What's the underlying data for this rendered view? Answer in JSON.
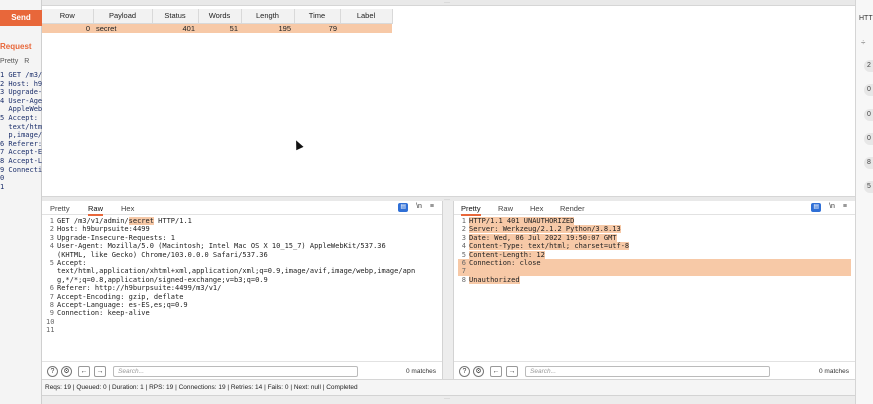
{
  "background_left": {
    "send_label": "Send",
    "request_heading": "Request",
    "tabs": [
      "Pretty",
      "R"
    ],
    "lines": [
      "1 GET /m3/",
      "2 Host: h9",
      "3 Upgrade-",
      "4 User-Age",
      "  AppleWeb",
      "5 Accept:",
      "  text/htm",
      "  p,image/",
      "6 Referer:",
      "7 Accept-E",
      "8 Accept-L",
      "9 Connecti",
      "0",
      "1"
    ]
  },
  "background_right": {
    "header_text": "HTT",
    "numbers": [
      "2",
      "0",
      "0",
      "0",
      "8",
      "5"
    ]
  },
  "results_table": {
    "columns": [
      "Row",
      "Payload",
      "Status",
      "Words",
      "Length",
      "Time",
      "Label"
    ],
    "rows": [
      {
        "row": "0",
        "payload": "secret",
        "status": "401",
        "words": "51",
        "length": "195",
        "time": "79",
        "label": ""
      }
    ]
  },
  "request_pane": {
    "tabs": [
      "Pretty",
      "Raw",
      "Hex"
    ],
    "active_tab": "Raw",
    "icons": [
      "message-icon",
      "newline-icon",
      "menu-icon"
    ],
    "newline_label": "\\n",
    "lines": [
      {
        "n": "1",
        "pre": "GET /m3/v1/admin/",
        "hl": "secret",
        "post": " HTTP/1.1"
      },
      {
        "n": "2",
        "pre": "Host: h9burpsuite:4499",
        "hl": "",
        "post": ""
      },
      {
        "n": "3",
        "pre": "Upgrade-Insecure-Requests: 1",
        "hl": "",
        "post": ""
      },
      {
        "n": "4",
        "pre": "User-Agent: Mozilla/5.0 (Macintosh; Intel Mac OS X 10_15_7) AppleWebKit/537.36",
        "hl": "",
        "post": ""
      },
      {
        "n": "",
        "pre": "(KHTML, like Gecko) Chrome/103.0.0.0 Safari/537.36",
        "hl": "",
        "post": ""
      },
      {
        "n": "5",
        "pre": "Accept:",
        "hl": "",
        "post": ""
      },
      {
        "n": "",
        "pre": "text/html,application/xhtml+xml,application/xml;q=0.9,image/avif,image/webp,image/apn",
        "hl": "",
        "post": ""
      },
      {
        "n": "",
        "pre": "g,*/*;q=0.8,application/signed-exchange;v=b3;q=0.9",
        "hl": "",
        "post": ""
      },
      {
        "n": "6",
        "pre": "Referer: http://h9burpsuite:4499/m3/v1/",
        "hl": "",
        "post": ""
      },
      {
        "n": "7",
        "pre": "Accept-Encoding: gzip, deflate",
        "hl": "",
        "post": ""
      },
      {
        "n": "8",
        "pre": "Accept-Language: es-ES,es;q=0.9",
        "hl": "",
        "post": ""
      },
      {
        "n": "9",
        "pre": "Connection: keep-alive",
        "hl": "",
        "post": ""
      },
      {
        "n": "10",
        "pre": "",
        "hl": "",
        "post": ""
      },
      {
        "n": "11",
        "pre": "",
        "hl": "",
        "post": ""
      }
    ],
    "search_placeholder": "Search...",
    "matches": "0 matches"
  },
  "response_pane": {
    "tabs": [
      "Pretty",
      "Raw",
      "Hex",
      "Render"
    ],
    "active_tab": "Pretty",
    "icons": [
      "message-icon",
      "newline-icon",
      "menu-icon"
    ],
    "newline_label": "\\n",
    "lines": [
      {
        "n": "1",
        "text": "HTTP/1.1 401 UNAUTHORIZED",
        "full": false
      },
      {
        "n": "2",
        "text": "Server: Werkzeug/2.1.2 Python/3.8.13",
        "full": false
      },
      {
        "n": "3",
        "text": "Date: Wed, 06 Jul 2022 19:50:07 GMT",
        "full": false
      },
      {
        "n": "4",
        "text": "Content-Type: text/html; charset=utf-8",
        "full": false
      },
      {
        "n": "5",
        "text": "Content-Length: 12",
        "full": false
      },
      {
        "n": "6",
        "text": "Connection: close",
        "full": true
      },
      {
        "n": "7",
        "text": "",
        "full": true
      },
      {
        "n": "8",
        "text": "Unauthorized",
        "full": false
      }
    ],
    "search_placeholder": "Search...",
    "matches": "0 matches"
  },
  "status_bar": {
    "text": "Reqs: 19 | Queued: 0 | Duration: 1 | RPS: 19 | Connections: 19 | Retries: 14 | Fails: 0 | Next: null | Completed"
  },
  "colors": {
    "accent": "#e8673a",
    "highlight": "#f7c9a7",
    "link_blue": "#2f6fd6"
  }
}
